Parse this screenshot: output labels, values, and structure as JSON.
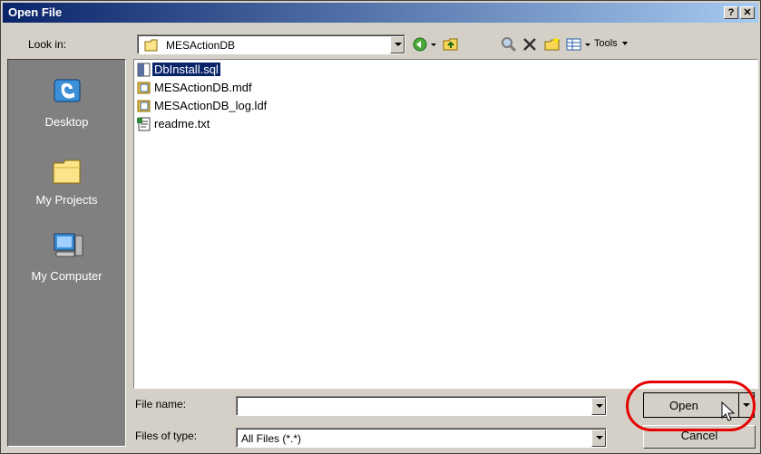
{
  "dialog": {
    "title": "Open File",
    "help_label": "?",
    "close_label": "✕"
  },
  "toolbar": {
    "look_in_label": "Look in:",
    "look_in_value": "MESActionDB",
    "tools_label": "Tools",
    "icons": [
      "back-icon",
      "up-folder-icon",
      "search-web-icon",
      "delete-icon",
      "new-folder-icon",
      "views-icon"
    ]
  },
  "places": [
    {
      "label": "Desktop",
      "icon": "desktop-icon"
    },
    {
      "label": "My Projects",
      "icon": "folder-icon"
    },
    {
      "label": "My Computer",
      "icon": "computer-icon"
    }
  ],
  "files": [
    {
      "name": "DbInstall.sql",
      "icon": "sql-file-icon",
      "selected": true
    },
    {
      "name": "MESActionDB.mdf",
      "icon": "database-file-icon",
      "selected": false
    },
    {
      "name": "MESActionDB_log.ldf",
      "icon": "database-file-icon",
      "selected": false
    },
    {
      "name": "readme.txt",
      "icon": "text-file-icon",
      "selected": false
    }
  ],
  "filename": {
    "label": "File name:",
    "value": ""
  },
  "filetype": {
    "label": "Files of type:",
    "value": "All Files (*.*)"
  },
  "buttons": {
    "open_label": "Open",
    "cancel_label": "Cancel"
  }
}
